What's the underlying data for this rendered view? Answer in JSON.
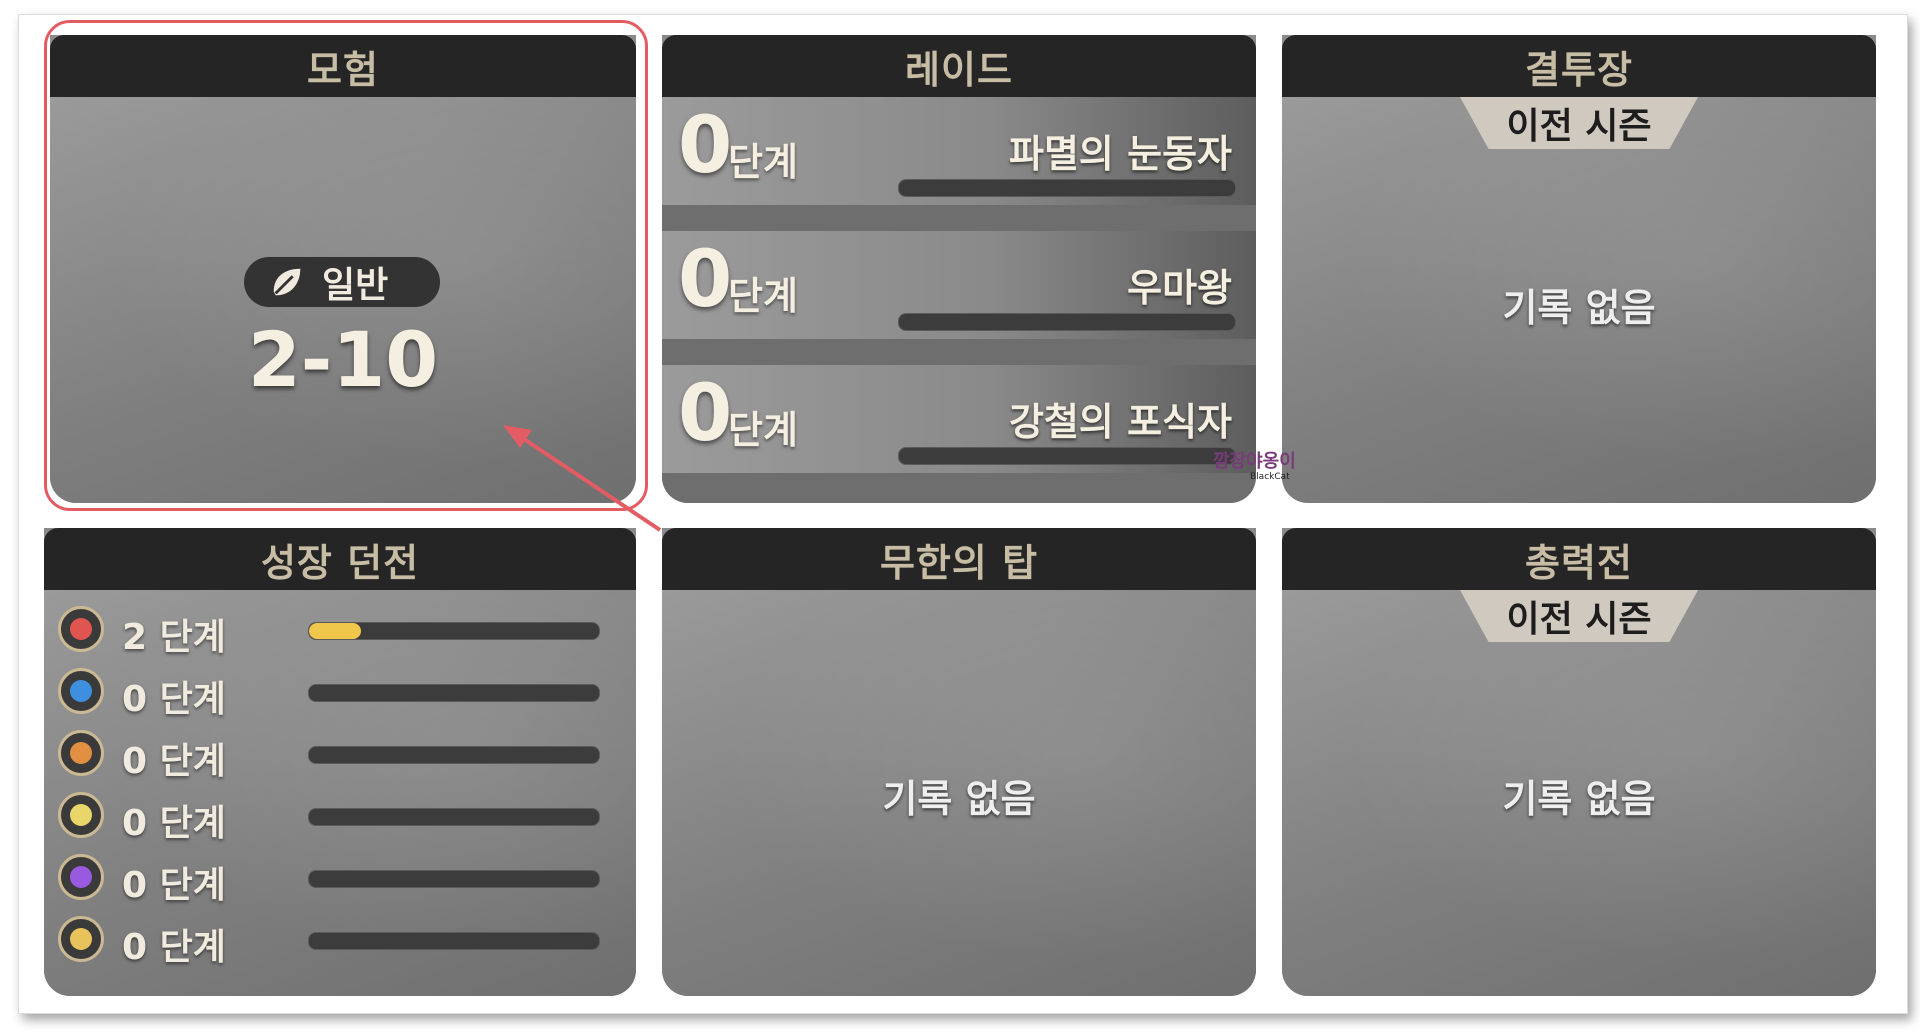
{
  "adventure": {
    "title": "모험",
    "mode_label": "일반",
    "stage": "2-10"
  },
  "raid": {
    "title": "레이드",
    "rows": [
      {
        "level": "0",
        "unit": "단계",
        "name": "파멸의 눈동자",
        "progress": 0
      },
      {
        "level": "0",
        "unit": "단계",
        "name": "우마왕",
        "progress": 0
      },
      {
        "level": "0",
        "unit": "단계",
        "name": "강철의 포식자",
        "progress": 0
      }
    ]
  },
  "arena": {
    "title": "결투장",
    "season_label": "이전 시즌",
    "empty_text": "기록 없음"
  },
  "growth_dungeon": {
    "title": "성장 던전",
    "rows": [
      {
        "level": "2 단계",
        "icon": "fire-element-icon",
        "color": "#e0554f",
        "progress": 0.18
      },
      {
        "level": "0 단계",
        "icon": "water-element-icon",
        "color": "#3f8fe0",
        "progress": 0
      },
      {
        "level": "0 단계",
        "icon": "earth-element-icon",
        "color": "#e09040",
        "progress": 0
      },
      {
        "level": "0 단계",
        "icon": "light-element-icon",
        "color": "#e8d66a",
        "progress": 0
      },
      {
        "level": "0 단계",
        "icon": "dark-element-icon",
        "color": "#9a5ae0",
        "progress": 0
      },
      {
        "level": "0 단계",
        "icon": "gold-element-icon",
        "color": "#e8c25a",
        "progress": 0
      }
    ]
  },
  "infinite_tower": {
    "title": "무한의 탑",
    "empty_text": "기록 없음"
  },
  "total_war": {
    "title": "총력전",
    "season_label": "이전 시즌",
    "empty_text": "기록 없음"
  },
  "watermark": {
    "text": "깜장야옹이",
    "sub": "BlackCat"
  },
  "colors": {
    "highlight": "#e45c63",
    "progress_fill": "#f1c74b",
    "header_bg": "#252525"
  }
}
